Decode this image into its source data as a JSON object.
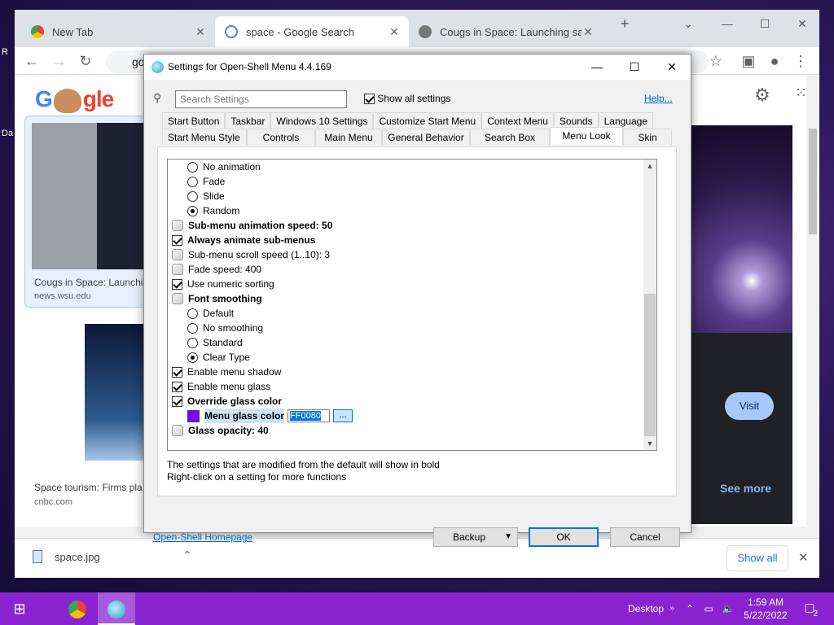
{
  "desktop": {
    "labels": [
      "R",
      "Da"
    ]
  },
  "browser": {
    "tabs": [
      {
        "title": "New Tab",
        "close": "✕"
      },
      {
        "title": "space - Google Search",
        "close": "✕"
      },
      {
        "title": "Cougs in Space: Launching satell",
        "close": "✕"
      }
    ],
    "new_tab": "+",
    "omnibox_text": "go",
    "page": {
      "logo_left": "G",
      "logo_right": "gle",
      "result1_caption": "Cougs in Space: Launchi",
      "result1_source": "news.wsu.edu",
      "result2_caption": "Space tourism: Firms pla",
      "result2_source": "cnbc.com",
      "visit": "Visit",
      "see_more": "See more"
    },
    "download": {
      "file": "space.jpg",
      "show_all": "Show all",
      "close": "✕"
    }
  },
  "dialog": {
    "title": "Settings for Open-Shell Menu 4.4.169",
    "search_placeholder": "Search Settings",
    "show_all_settings": "Show all settings",
    "help": "Help...",
    "tabs_row1": [
      "Start Button",
      "Taskbar",
      "Windows 10 Settings",
      "Customize Start Menu",
      "Context Menu",
      "Sounds",
      "Language"
    ],
    "tabs_row2": [
      "Start Menu Style",
      "Controls",
      "Main Menu",
      "General Behavior",
      "Search Box",
      "Menu Look",
      "Skin"
    ],
    "active_tab": "Menu Look",
    "settings": [
      {
        "type": "radio",
        "label": "No animation",
        "checked": false,
        "bold": false
      },
      {
        "type": "radio",
        "label": "Fade",
        "checked": false,
        "bold": false
      },
      {
        "type": "radio",
        "label": "Slide",
        "checked": false,
        "bold": false
      },
      {
        "type": "radio",
        "label": "Random",
        "checked": true,
        "bold": false
      },
      {
        "type": "value",
        "label": "Sub-menu animation speed: 50",
        "bold": true
      },
      {
        "type": "check",
        "label": "Always animate sub-menus",
        "checked": true,
        "bold": true
      },
      {
        "type": "value",
        "label": "Sub-menu scroll speed (1..10): 3",
        "bold": false
      },
      {
        "type": "value",
        "label": "Fade speed: 400",
        "bold": false
      },
      {
        "type": "check",
        "label": "Use numeric sorting",
        "checked": true,
        "bold": false
      },
      {
        "type": "value",
        "label": "Font smoothing",
        "bold": true
      },
      {
        "type": "radio",
        "label": "Default",
        "checked": false,
        "bold": false
      },
      {
        "type": "radio",
        "label": "No smoothing",
        "checked": false,
        "bold": false
      },
      {
        "type": "radio",
        "label": "Standard",
        "checked": false,
        "bold": false
      },
      {
        "type": "radio",
        "label": "Clear Type",
        "checked": true,
        "bold": false
      },
      {
        "type": "check",
        "label": "Enable menu shadow",
        "checked": true,
        "bold": false
      },
      {
        "type": "check",
        "label": "Enable menu glass",
        "checked": true,
        "bold": false
      },
      {
        "type": "check",
        "label": "Override glass color",
        "checked": true,
        "bold": true
      },
      {
        "type": "color",
        "label": "Menu glass color",
        "value": "FF0080",
        "bold": true
      },
      {
        "type": "value",
        "label": "Glass opacity: 40",
        "bold": true
      }
    ],
    "color_button": "...",
    "swatch_color": "#8000ff",
    "note1": "The settings that are modified from the default will show in bold",
    "note2": "Right-click on a setting for more functions",
    "homepage": "Open-Shell Homepage",
    "buttons": {
      "backup": "Backup",
      "ok": "OK",
      "cancel": "Cancel"
    }
  },
  "taskbar": {
    "desktop": "Desktop",
    "time": "1:59 AM",
    "date": "5/22/2022",
    "notifications": "2",
    "accent": "#8a24d0"
  }
}
